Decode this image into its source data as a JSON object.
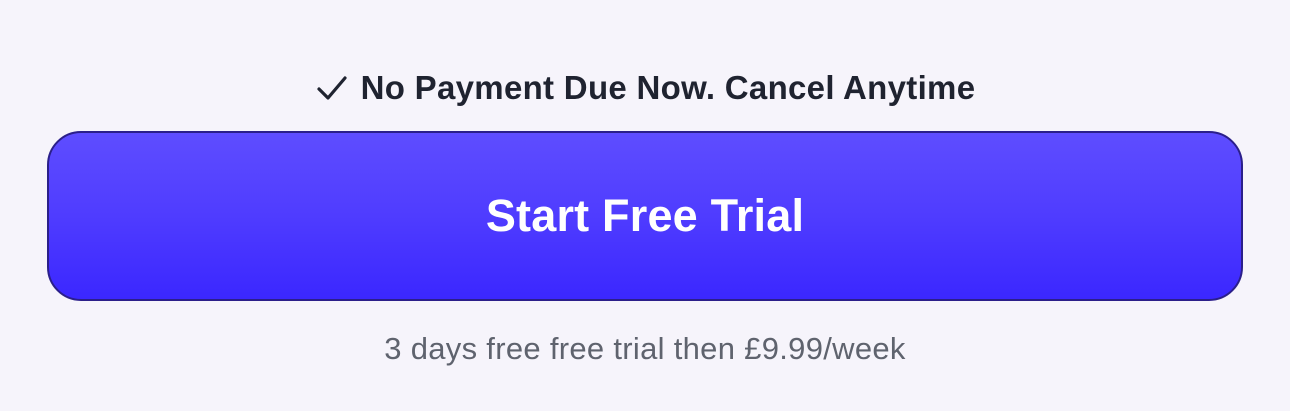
{
  "notice": {
    "icon": "check-icon",
    "text": "No Payment Due Now. Cancel Anytime"
  },
  "cta": {
    "label": "Start Free Trial"
  },
  "pricing": {
    "text": "3 days free free trial then £9.99/week"
  },
  "colors": {
    "background": "#f6f4fb",
    "button_top": "#5e4dff",
    "button_bottom": "#3b27ff",
    "button_border": "#2b1f8a",
    "button_text": "#ffffff",
    "notice_text": "#1f2330",
    "secondary_text": "#5f636e"
  }
}
